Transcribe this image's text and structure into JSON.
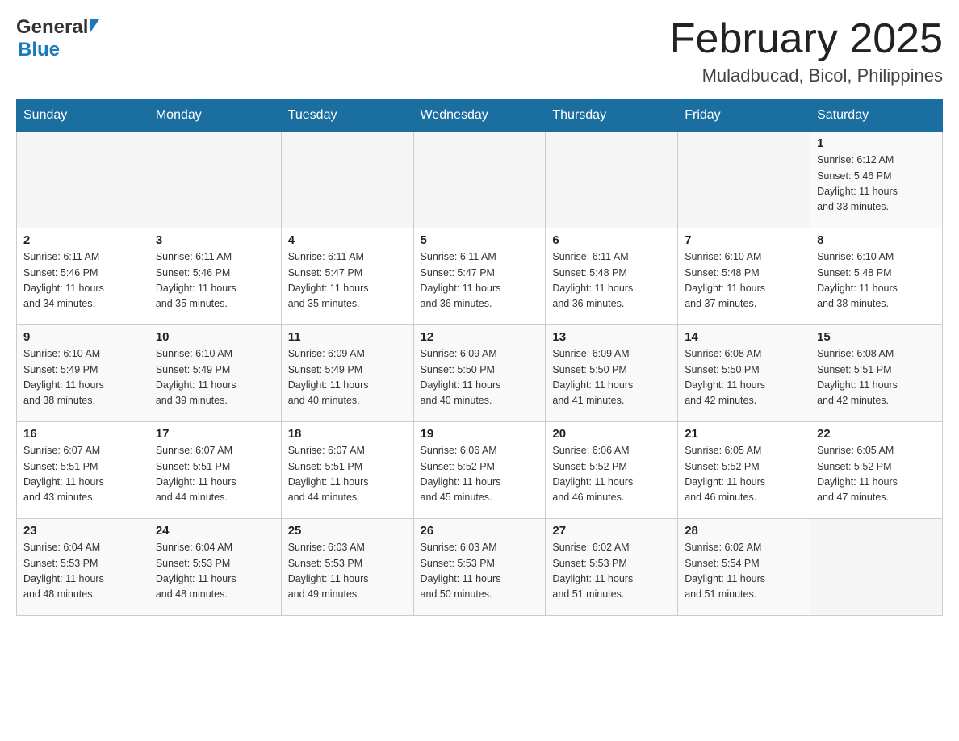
{
  "header": {
    "logo_general": "General",
    "logo_blue": "Blue",
    "month_title": "February 2025",
    "location": "Muladbucad, Bicol, Philippines"
  },
  "days_of_week": [
    "Sunday",
    "Monday",
    "Tuesday",
    "Wednesday",
    "Thursday",
    "Friday",
    "Saturday"
  ],
  "weeks": [
    {
      "days": [
        {
          "date": "",
          "info": ""
        },
        {
          "date": "",
          "info": ""
        },
        {
          "date": "",
          "info": ""
        },
        {
          "date": "",
          "info": ""
        },
        {
          "date": "",
          "info": ""
        },
        {
          "date": "",
          "info": ""
        },
        {
          "date": "1",
          "info": "Sunrise: 6:12 AM\nSunset: 5:46 PM\nDaylight: 11 hours\nand 33 minutes."
        }
      ]
    },
    {
      "days": [
        {
          "date": "2",
          "info": "Sunrise: 6:11 AM\nSunset: 5:46 PM\nDaylight: 11 hours\nand 34 minutes."
        },
        {
          "date": "3",
          "info": "Sunrise: 6:11 AM\nSunset: 5:46 PM\nDaylight: 11 hours\nand 35 minutes."
        },
        {
          "date": "4",
          "info": "Sunrise: 6:11 AM\nSunset: 5:47 PM\nDaylight: 11 hours\nand 35 minutes."
        },
        {
          "date": "5",
          "info": "Sunrise: 6:11 AM\nSunset: 5:47 PM\nDaylight: 11 hours\nand 36 minutes."
        },
        {
          "date": "6",
          "info": "Sunrise: 6:11 AM\nSunset: 5:48 PM\nDaylight: 11 hours\nand 36 minutes."
        },
        {
          "date": "7",
          "info": "Sunrise: 6:10 AM\nSunset: 5:48 PM\nDaylight: 11 hours\nand 37 minutes."
        },
        {
          "date": "8",
          "info": "Sunrise: 6:10 AM\nSunset: 5:48 PM\nDaylight: 11 hours\nand 38 minutes."
        }
      ]
    },
    {
      "days": [
        {
          "date": "9",
          "info": "Sunrise: 6:10 AM\nSunset: 5:49 PM\nDaylight: 11 hours\nand 38 minutes."
        },
        {
          "date": "10",
          "info": "Sunrise: 6:10 AM\nSunset: 5:49 PM\nDaylight: 11 hours\nand 39 minutes."
        },
        {
          "date": "11",
          "info": "Sunrise: 6:09 AM\nSunset: 5:49 PM\nDaylight: 11 hours\nand 40 minutes."
        },
        {
          "date": "12",
          "info": "Sunrise: 6:09 AM\nSunset: 5:50 PM\nDaylight: 11 hours\nand 40 minutes."
        },
        {
          "date": "13",
          "info": "Sunrise: 6:09 AM\nSunset: 5:50 PM\nDaylight: 11 hours\nand 41 minutes."
        },
        {
          "date": "14",
          "info": "Sunrise: 6:08 AM\nSunset: 5:50 PM\nDaylight: 11 hours\nand 42 minutes."
        },
        {
          "date": "15",
          "info": "Sunrise: 6:08 AM\nSunset: 5:51 PM\nDaylight: 11 hours\nand 42 minutes."
        }
      ]
    },
    {
      "days": [
        {
          "date": "16",
          "info": "Sunrise: 6:07 AM\nSunset: 5:51 PM\nDaylight: 11 hours\nand 43 minutes."
        },
        {
          "date": "17",
          "info": "Sunrise: 6:07 AM\nSunset: 5:51 PM\nDaylight: 11 hours\nand 44 minutes."
        },
        {
          "date": "18",
          "info": "Sunrise: 6:07 AM\nSunset: 5:51 PM\nDaylight: 11 hours\nand 44 minutes."
        },
        {
          "date": "19",
          "info": "Sunrise: 6:06 AM\nSunset: 5:52 PM\nDaylight: 11 hours\nand 45 minutes."
        },
        {
          "date": "20",
          "info": "Sunrise: 6:06 AM\nSunset: 5:52 PM\nDaylight: 11 hours\nand 46 minutes."
        },
        {
          "date": "21",
          "info": "Sunrise: 6:05 AM\nSunset: 5:52 PM\nDaylight: 11 hours\nand 46 minutes."
        },
        {
          "date": "22",
          "info": "Sunrise: 6:05 AM\nSunset: 5:52 PM\nDaylight: 11 hours\nand 47 minutes."
        }
      ]
    },
    {
      "days": [
        {
          "date": "23",
          "info": "Sunrise: 6:04 AM\nSunset: 5:53 PM\nDaylight: 11 hours\nand 48 minutes."
        },
        {
          "date": "24",
          "info": "Sunrise: 6:04 AM\nSunset: 5:53 PM\nDaylight: 11 hours\nand 48 minutes."
        },
        {
          "date": "25",
          "info": "Sunrise: 6:03 AM\nSunset: 5:53 PM\nDaylight: 11 hours\nand 49 minutes."
        },
        {
          "date": "26",
          "info": "Sunrise: 6:03 AM\nSunset: 5:53 PM\nDaylight: 11 hours\nand 50 minutes."
        },
        {
          "date": "27",
          "info": "Sunrise: 6:02 AM\nSunset: 5:53 PM\nDaylight: 11 hours\nand 51 minutes."
        },
        {
          "date": "28",
          "info": "Sunrise: 6:02 AM\nSunset: 5:54 PM\nDaylight: 11 hours\nand 51 minutes."
        },
        {
          "date": "",
          "info": ""
        }
      ]
    }
  ]
}
